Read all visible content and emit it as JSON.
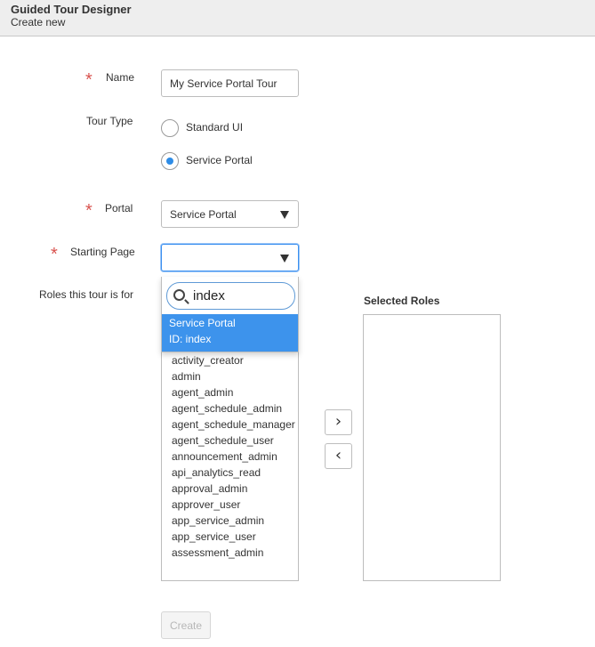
{
  "header": {
    "title": "Guided Tour Designer",
    "subtitle": "Create new"
  },
  "form": {
    "name": {
      "label": "Name",
      "value": "My Service Portal Tour",
      "required": true
    },
    "tour_type": {
      "label": "Tour Type",
      "options": [
        {
          "label": "Standard UI",
          "checked": false
        },
        {
          "label": "Service Portal",
          "checked": true
        }
      ]
    },
    "portal": {
      "label": "Portal",
      "value": "Service Portal",
      "required": true
    },
    "starting_page": {
      "label": "Starting Page",
      "value": "",
      "required": true,
      "dropdown": {
        "search_value": "index",
        "highlighted_option": {
          "title": "Service Portal",
          "id": "ID: index"
        }
      }
    },
    "roles": {
      "label": "Roles this tour is for",
      "available": [
        "activity_creator",
        "admin",
        "agent_admin",
        "agent_schedule_admin",
        "agent_schedule_manager",
        "agent_schedule_user",
        "announcement_admin",
        "api_analytics_read",
        "approval_admin",
        "approver_user",
        "app_service_admin",
        "app_service_user",
        "assessment_admin"
      ],
      "add_button": "›",
      "remove_button": "‹",
      "selected_heading": "Selected Roles",
      "selected": []
    },
    "create_button": "Create"
  },
  "colors": {
    "required": "#d9534f",
    "accent": "#3d93ec",
    "header_bg": "#eeeeee"
  }
}
